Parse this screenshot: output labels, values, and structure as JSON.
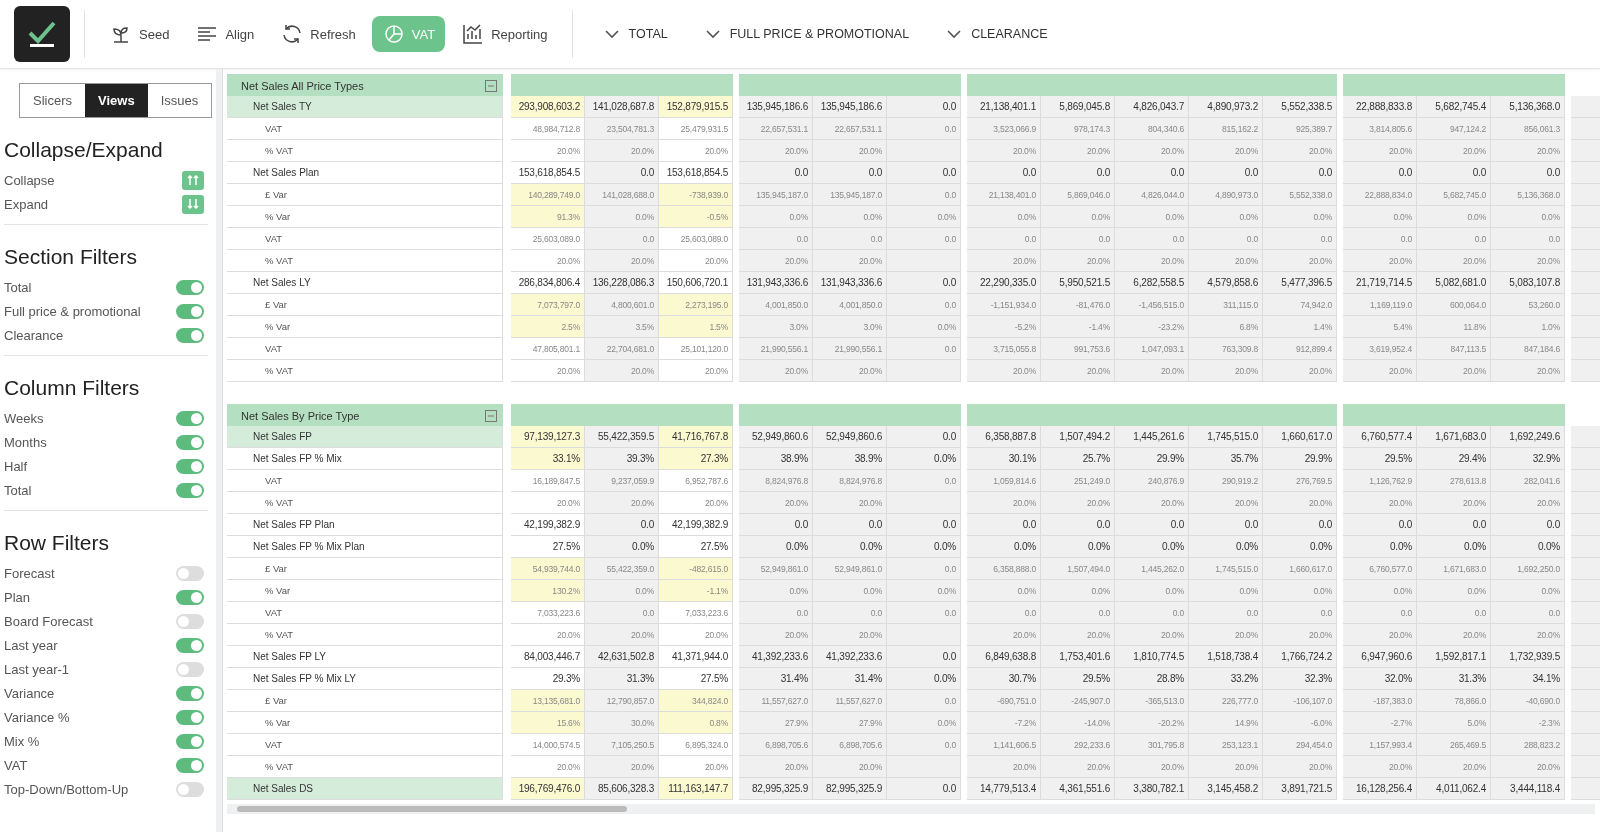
{
  "toolbar": {
    "buttons": [
      {
        "label": "Seed",
        "selected": false
      },
      {
        "label": "Align",
        "selected": false
      },
      {
        "label": "Refresh",
        "selected": false
      },
      {
        "label": "VAT",
        "selected": true
      },
      {
        "label": "Reporting",
        "selected": false
      }
    ],
    "dropdowns": [
      "TOTAL",
      "FULL PRICE & PROMOTIONAL",
      "CLEARANCE"
    ]
  },
  "sidebar": {
    "tabs": [
      {
        "label": "Slicers",
        "selected": false
      },
      {
        "label": "Views",
        "selected": true
      },
      {
        "label": "Issues",
        "selected": false
      }
    ],
    "groups": [
      {
        "title": "Collapse/Expand",
        "items": [
          {
            "label": "Collapse",
            "kind": "collapse"
          },
          {
            "label": "Expand",
            "kind": "expand"
          }
        ]
      },
      {
        "title": "Section Filters",
        "items": [
          {
            "label": "Total",
            "kind": "toggle",
            "on": true
          },
          {
            "label": "Full price & promotional",
            "kind": "toggle",
            "on": true
          },
          {
            "label": "Clearance",
            "kind": "toggle",
            "on": true
          }
        ]
      },
      {
        "title": "Column Filters",
        "items": [
          {
            "label": "Weeks",
            "kind": "toggle",
            "on": true
          },
          {
            "label": "Months",
            "kind": "toggle",
            "on": true
          },
          {
            "label": "Half",
            "kind": "toggle",
            "on": true
          },
          {
            "label": "Total",
            "kind": "toggle",
            "on": true
          }
        ]
      },
      {
        "title": "Row Filters",
        "items": [
          {
            "label": "Forecast",
            "kind": "toggle",
            "on": false
          },
          {
            "label": "Plan",
            "kind": "toggle",
            "on": true
          },
          {
            "label": "Board Forecast",
            "kind": "toggle",
            "on": false
          },
          {
            "label": "Last year",
            "kind": "toggle",
            "on": true
          },
          {
            "label": "Last year-1",
            "kind": "toggle",
            "on": false
          },
          {
            "label": "Variance",
            "kind": "toggle",
            "on": true
          },
          {
            "label": "Variance %",
            "kind": "toggle",
            "on": true
          },
          {
            "label": "Mix %",
            "kind": "toggle",
            "on": true
          },
          {
            "label": "VAT",
            "kind": "toggle",
            "on": true
          },
          {
            "label": "Top-Down/Bottom-Up",
            "kind": "toggle",
            "on": false
          }
        ]
      }
    ]
  },
  "sections": [
    {
      "title": "Net Sales All Price Types",
      "rows": [
        {
          "label": "Net Sales TY",
          "kind": "main",
          "selected": true,
          "highlighted": true,
          "groups": [
            [
              "293,908,603.2",
              "141,028,687.8",
              "152,879,915.5"
            ],
            [
              "135,945,186.6",
              "135,945,186.6",
              "0.0"
            ],
            [
              "21,138,401.1",
              "5,869,045.8",
              "4,826,043.7",
              "4,890,973.2",
              "5,552,338.5"
            ],
            [
              "22,888,833.8",
              "5,682,745.4",
              "5,136,368.0"
            ]
          ]
        },
        {
          "label": "VAT",
          "kind": "sub",
          "selected": false,
          "highlighted": false,
          "groups": [
            [
              "48,984,712.8",
              "23,504,781.3",
              "25,479,931.5"
            ],
            [
              "22,657,531.1",
              "22,657,531.1",
              "0.0"
            ],
            [
              "3,523,066.9",
              "978,174.3",
              "804,340.6",
              "815,162.2",
              "925,389.7"
            ],
            [
              "3,814,805.6",
              "947,124.2",
              "856,061.3"
            ]
          ]
        },
        {
          "label": "% VAT",
          "kind": "sub",
          "selected": false,
          "highlighted": false,
          "groups": [
            [
              "20.0%",
              "20.0%",
              "20.0%"
            ],
            [
              "20.0%",
              "20.0%"
            ],
            [
              "20.0%",
              "20.0%",
              "20.0%",
              "20.0%",
              "20.0%"
            ],
            [
              "20.0%",
              "20.0%",
              "20.0%"
            ]
          ]
        },
        {
          "label": "Net Sales Plan",
          "kind": "main",
          "selected": false,
          "highlighted": false,
          "groups": [
            [
              "153,618,854.5",
              "0.0",
              "153,618,854.5"
            ],
            [
              "0.0",
              "0.0",
              "0.0"
            ],
            [
              "0.0",
              "0.0",
              "0.0",
              "0.0",
              "0.0"
            ],
            [
              "0.0",
              "0.0",
              "0.0"
            ]
          ]
        },
        {
          "label": "£ Var",
          "kind": "sub",
          "selected": false,
          "highlighted": true,
          "groups": [
            [
              "140,289,749.0",
              "141,028,688.0",
              "-738,939.0"
            ],
            [
              "135,945,187.0",
              "135,945,187.0",
              "0.0"
            ],
            [
              "21,138,401.0",
              "5,869,046.0",
              "4,826,044.0",
              "4,890,973.0",
              "5,552,338.0"
            ],
            [
              "22,888,834.0",
              "5,682,745.0",
              "5,136,368.0"
            ]
          ]
        },
        {
          "label": "% Var",
          "kind": "sub",
          "selected": false,
          "highlighted": true,
          "groups": [
            [
              "91.3%",
              "0.0%",
              "-0.5%"
            ],
            [
              "0.0%",
              "0.0%",
              "0.0%"
            ],
            [
              "0.0%",
              "0.0%",
              "0.0%",
              "0.0%",
              "0.0%"
            ],
            [
              "0.0%",
              "0.0%",
              "0.0%"
            ]
          ]
        },
        {
          "label": "VAT",
          "kind": "sub",
          "selected": false,
          "highlighted": false,
          "groups": [
            [
              "25,603,089.0",
              "0.0",
              "25,603,089.0"
            ],
            [
              "0.0",
              "0.0",
              "0.0"
            ],
            [
              "0.0",
              "0.0",
              "0.0",
              "0.0",
              "0.0"
            ],
            [
              "0.0",
              "0.0",
              "0.0"
            ]
          ]
        },
        {
          "label": "% VAT",
          "kind": "sub",
          "selected": false,
          "highlighted": false,
          "groups": [
            [
              "20.0%",
              "20.0%",
              "20.0%"
            ],
            [
              "20.0%",
              "20.0%"
            ],
            [
              "20.0%",
              "20.0%",
              "20.0%",
              "20.0%",
              "20.0%"
            ],
            [
              "20.0%",
              "20.0%",
              "20.0%"
            ]
          ]
        },
        {
          "label": "Net Sales LY",
          "kind": "main",
          "selected": false,
          "highlighted": false,
          "groups": [
            [
              "286,834,806.4",
              "136,228,086.3",
              "150,606,720.1"
            ],
            [
              "131,943,336.6",
              "131,943,336.6",
              "0.0"
            ],
            [
              "22,290,335.0",
              "5,950,521.5",
              "6,282,558.5",
              "4,579,858.6",
              "5,477,396.5"
            ],
            [
              "21,719,714.5",
              "5,082,681.0",
              "5,083,107.8"
            ]
          ]
        },
        {
          "label": "£ Var",
          "kind": "sub",
          "selected": false,
          "highlighted": true,
          "groups": [
            [
              "7,073,797.0",
              "4,800,601.0",
              "2,273,195.0"
            ],
            [
              "4,001,850.0",
              "4,001,850.0",
              "0.0"
            ],
            [
              "-1,151,934.0",
              "-81,476.0",
              "-1,456,515.0",
              "311,115.0",
              "74,942.0"
            ],
            [
              "1,169,119.0",
              "600,064.0",
              "53,260.0"
            ]
          ]
        },
        {
          "label": "% Var",
          "kind": "sub",
          "selected": false,
          "highlighted": true,
          "groups": [
            [
              "2.5%",
              "3.5%",
              "1.5%"
            ],
            [
              "3.0%",
              "3.0%",
              "0.0%"
            ],
            [
              "-5.2%",
              "-1.4%",
              "-23.2%",
              "6.8%",
              "1.4%"
            ],
            [
              "5.4%",
              "11.8%",
              "1.0%"
            ]
          ]
        },
        {
          "label": "VAT",
          "kind": "sub",
          "selected": false,
          "highlighted": false,
          "groups": [
            [
              "47,805,801.1",
              "22,704,681.0",
              "25,101,120.0"
            ],
            [
              "21,990,556.1",
              "21,990,556.1",
              "0.0"
            ],
            [
              "3,715,055.8",
              "991,753.6",
              "1,047,093.1",
              "763,309.8",
              "912,899.4"
            ],
            [
              "3,619,952.4",
              "847,113.5",
              "847,184.6"
            ]
          ]
        },
        {
          "label": "% VAT",
          "kind": "sub",
          "selected": false,
          "highlighted": false,
          "groups": [
            [
              "20.0%",
              "20.0%",
              "20.0%"
            ],
            [
              "20.0%",
              "20.0%"
            ],
            [
              "20.0%",
              "20.0%",
              "20.0%",
              "20.0%",
              "20.0%"
            ],
            [
              "20.0%",
              "20.0%",
              "20.0%"
            ]
          ]
        }
      ]
    },
    {
      "title": "Net Sales By Price Type",
      "rows": [
        {
          "label": "Net Sales FP",
          "kind": "main",
          "selected": true,
          "highlighted": true,
          "groups": [
            [
              "97,139,127.3",
              "55,422,359.5",
              "41,716,767.8"
            ],
            [
              "52,949,860.6",
              "52,949,860.6",
              "0.0"
            ],
            [
              "6,358,887.8",
              "1,507,494.2",
              "1,445,261.6",
              "1,745,515.0",
              "1,660,617.0"
            ],
            [
              "6,760,577.4",
              "1,671,683.0",
              "1,692,249.6"
            ]
          ]
        },
        {
          "label": "Net Sales FP % Mix",
          "kind": "main",
          "selected": false,
          "highlighted": true,
          "groups": [
            [
              "33.1%",
              "39.3%",
              "27.3%"
            ],
            [
              "38.9%",
              "38.9%",
              "0.0%"
            ],
            [
              "30.1%",
              "25.7%",
              "29.9%",
              "35.7%",
              "29.9%"
            ],
            [
              "29.5%",
              "29.4%",
              "32.9%"
            ]
          ]
        },
        {
          "label": "VAT",
          "kind": "sub",
          "selected": false,
          "highlighted": false,
          "groups": [
            [
              "16,189,847.5",
              "9,237,059.9",
              "6,952,787.6"
            ],
            [
              "8,824,976.8",
              "8,824,976.8",
              "0.0"
            ],
            [
              "1,059,814.6",
              "251,249.0",
              "240,876.9",
              "290,919.2",
              "276,769.5"
            ],
            [
              "1,126,762.9",
              "278,613.8",
              "282,041.6"
            ]
          ]
        },
        {
          "label": "% VAT",
          "kind": "sub",
          "selected": false,
          "highlighted": false,
          "groups": [
            [
              "20.0%",
              "20.0%",
              "20.0%"
            ],
            [
              "20.0%",
              "20.0%"
            ],
            [
              "20.0%",
              "20.0%",
              "20.0%",
              "20.0%",
              "20.0%"
            ],
            [
              "20.0%",
              "20.0%",
              "20.0%"
            ]
          ]
        },
        {
          "label": "Net Sales FP Plan",
          "kind": "main",
          "selected": false,
          "highlighted": false,
          "groups": [
            [
              "42,199,382.9",
              "0.0",
              "42,199,382.9"
            ],
            [
              "0.0",
              "0.0",
              "0.0"
            ],
            [
              "0.0",
              "0.0",
              "0.0",
              "0.0",
              "0.0"
            ],
            [
              "0.0",
              "0.0",
              "0.0"
            ]
          ]
        },
        {
          "label": "Net Sales FP % Mix Plan",
          "kind": "main",
          "selected": false,
          "highlighted": false,
          "groups": [
            [
              "27.5%",
              "0.0%",
              "27.5%"
            ],
            [
              "0.0%",
              "0.0%",
              "0.0%"
            ],
            [
              "0.0%",
              "0.0%",
              "0.0%",
              "0.0%",
              "0.0%"
            ],
            [
              "0.0%",
              "0.0%",
              "0.0%"
            ]
          ]
        },
        {
          "label": "£ Var",
          "kind": "sub",
          "selected": false,
          "highlighted": true,
          "groups": [
            [
              "54,939,744.0",
              "55,422,359.0",
              "-482,615.0"
            ],
            [
              "52,949,861.0",
              "52,949,861.0",
              "0.0"
            ],
            [
              "6,358,888.0",
              "1,507,494.0",
              "1,445,262.0",
              "1,745,515.0",
              "1,660,617.0"
            ],
            [
              "6,760,577.0",
              "1,671,683.0",
              "1,692,250.0"
            ]
          ]
        },
        {
          "label": "% Var",
          "kind": "sub",
          "selected": false,
          "highlighted": true,
          "groups": [
            [
              "130.2%",
              "0.0%",
              "-1.1%"
            ],
            [
              "0.0%",
              "0.0%",
              "0.0%"
            ],
            [
              "0.0%",
              "0.0%",
              "0.0%",
              "0.0%",
              "0.0%"
            ],
            [
              "0.0%",
              "0.0%",
              "0.0%"
            ]
          ]
        },
        {
          "label": "VAT",
          "kind": "sub",
          "selected": false,
          "highlighted": false,
          "groups": [
            [
              "7,033,223.6",
              "0.0",
              "7,033,223.6"
            ],
            [
              "0.0",
              "0.0",
              "0.0"
            ],
            [
              "0.0",
              "0.0",
              "0.0",
              "0.0",
              "0.0"
            ],
            [
              "0.0",
              "0.0",
              "0.0"
            ]
          ]
        },
        {
          "label": "% VAT",
          "kind": "sub",
          "selected": false,
          "highlighted": false,
          "groups": [
            [
              "20.0%",
              "20.0%",
              "20.0%"
            ],
            [
              "20.0%",
              "20.0%"
            ],
            [
              "20.0%",
              "20.0%",
              "20.0%",
              "20.0%",
              "20.0%"
            ],
            [
              "20.0%",
              "20.0%",
              "20.0%"
            ]
          ]
        },
        {
          "label": "Net Sales FP LY",
          "kind": "main",
          "selected": false,
          "highlighted": false,
          "groups": [
            [
              "84,003,446.7",
              "42,631,502.8",
              "41,371,944.0"
            ],
            [
              "41,392,233.6",
              "41,392,233.6",
              "0.0"
            ],
            [
              "6,849,638.8",
              "1,753,401.6",
              "1,810,774.5",
              "1,518,738.4",
              "1,766,724.2"
            ],
            [
              "6,947,960.6",
              "1,592,817.1",
              "1,732,939.5"
            ]
          ]
        },
        {
          "label": "Net Sales FP % Mix LY",
          "kind": "main",
          "selected": false,
          "highlighted": false,
          "groups": [
            [
              "29.3%",
              "31.3%",
              "27.5%"
            ],
            [
              "31.4%",
              "31.4%",
              "0.0%"
            ],
            [
              "30.7%",
              "29.5%",
              "28.8%",
              "33.2%",
              "32.3%"
            ],
            [
              "32.0%",
              "31.3%",
              "34.1%"
            ]
          ]
        },
        {
          "label": "£ Var",
          "kind": "sub",
          "selected": false,
          "highlighted": true,
          "groups": [
            [
              "13,135,681.0",
              "12,790,857.0",
              "344,824.0"
            ],
            [
              "11,557,627.0",
              "11,557,627.0",
              "0.0"
            ],
            [
              "-690,751.0",
              "-245,907.0",
              "-365,513.0",
              "226,777.0",
              "-106,107.0"
            ],
            [
              "-187,383.0",
              "78,866.0",
              "-40,690.0"
            ]
          ]
        },
        {
          "label": "% Var",
          "kind": "sub",
          "selected": false,
          "highlighted": true,
          "groups": [
            [
              "15.6%",
              "30.0%",
              "0.8%"
            ],
            [
              "27.9%",
              "27.9%",
              "0.0%"
            ],
            [
              "-7.2%",
              "-14.0%",
              "-20.2%",
              "14.9%",
              "-6.0%"
            ],
            [
              "-2.7%",
              "5.0%",
              "-2.3%"
            ]
          ]
        },
        {
          "label": "VAT",
          "kind": "sub",
          "selected": false,
          "highlighted": false,
          "groups": [
            [
              "14,000,574.5",
              "7,105,250.5",
              "6,895,324.0"
            ],
            [
              "6,898,705.6",
              "6,898,705.6",
              "0.0"
            ],
            [
              "1,141,606.5",
              "292,233.6",
              "301,795.8",
              "253,123.1",
              "294,454.0"
            ],
            [
              "1,157,993.4",
              "265,469.5",
              "288,823.2"
            ]
          ]
        },
        {
          "label": "% VAT",
          "kind": "sub",
          "selected": false,
          "highlighted": false,
          "groups": [
            [
              "20.0%",
              "20.0%",
              "20.0%"
            ],
            [
              "20.0%",
              "20.0%"
            ],
            [
              "20.0%",
              "20.0%",
              "20.0%",
              "20.0%",
              "20.0%"
            ],
            [
              "20.0%",
              "20.0%",
              "20.0%"
            ]
          ]
        },
        {
          "label": "Net Sales DS",
          "kind": "main",
          "selected": true,
          "highlighted": true,
          "groups": [
            [
              "196,769,476.0",
              "85,606,328.3",
              "111,163,147.7"
            ],
            [
              "82,995,325.9",
              "82,995,325.9",
              "0.0"
            ],
            [
              "14,779,513.4",
              "4,361,551.6",
              "3,380,782.1",
              "3,145,458.2",
              "3,891,721.5"
            ],
            [
              "16,128,256.4",
              "4,011,062.4",
              "3,444,118.4"
            ]
          ]
        }
      ]
    }
  ]
}
